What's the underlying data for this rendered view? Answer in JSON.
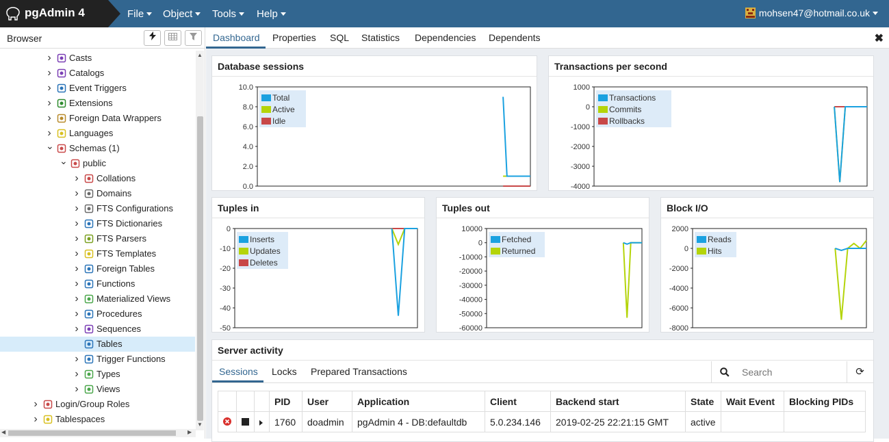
{
  "app": {
    "title": "pgAdmin 4"
  },
  "menu": {
    "file": "File",
    "object": "Object",
    "tools": "Tools",
    "help": "Help"
  },
  "user": {
    "email": "mohsen47@hotmail.co.uk"
  },
  "browser": {
    "title": "Browser",
    "tree": [
      {
        "label": "Casts",
        "icon": "casts-icon"
      },
      {
        "label": "Catalogs",
        "icon": "catalogs-icon"
      },
      {
        "label": "Event Triggers",
        "icon": "event-triggers-icon"
      },
      {
        "label": "Extensions",
        "icon": "extensions-icon"
      },
      {
        "label": "Foreign Data Wrappers",
        "icon": "fdw-icon"
      },
      {
        "label": "Languages",
        "icon": "languages-icon"
      },
      {
        "label": "Schemas (1)",
        "icon": "schemas-icon"
      },
      {
        "label": "public",
        "icon": "schema-icon"
      },
      {
        "label": "Collations",
        "icon": "collations-icon"
      },
      {
        "label": "Domains",
        "icon": "domains-icon"
      },
      {
        "label": "FTS Configurations",
        "icon": "fts-configurations-icon"
      },
      {
        "label": "FTS Dictionaries",
        "icon": "fts-dictionaries-icon"
      },
      {
        "label": "FTS Parsers",
        "icon": "fts-parsers-icon"
      },
      {
        "label": "FTS Templates",
        "icon": "fts-templates-icon"
      },
      {
        "label": "Foreign Tables",
        "icon": "foreign-tables-icon"
      },
      {
        "label": "Functions",
        "icon": "functions-icon"
      },
      {
        "label": "Materialized Views",
        "icon": "materialized-views-icon"
      },
      {
        "label": "Procedures",
        "icon": "procedures-icon"
      },
      {
        "label": "Sequences",
        "icon": "sequences-icon"
      },
      {
        "label": "Tables",
        "icon": "tables-icon"
      },
      {
        "label": "Trigger Functions",
        "icon": "trigger-functions-icon"
      },
      {
        "label": "Types",
        "icon": "types-icon"
      },
      {
        "label": "Views",
        "icon": "views-icon"
      },
      {
        "label": "Login/Group Roles",
        "icon": "roles-icon"
      },
      {
        "label": "Tablespaces",
        "icon": "tablespaces-icon"
      }
    ]
  },
  "tabs": [
    "Dashboard",
    "Properties",
    "SQL",
    "Statistics",
    "Dependencies",
    "Dependents"
  ],
  "panels": {
    "sessions": "Database sessions",
    "tps": "Transactions per second",
    "tuples_in": "Tuples in",
    "tuples_out": "Tuples out",
    "block_io": "Block I/O",
    "server_activity": "Server activity"
  },
  "activity": {
    "tabs": [
      "Sessions",
      "Locks",
      "Prepared Transactions"
    ],
    "search_placeholder": "Search",
    "columns": [
      "PID",
      "User",
      "Application",
      "Client",
      "Backend start",
      "State",
      "Wait Event",
      "Blocking PIDs"
    ],
    "rows": [
      {
        "pid": "1760",
        "user": "doadmin",
        "application": "pgAdmin 4 - DB:defaultdb",
        "client": "5.0.234.146",
        "backend_start": "2019-02-25 22:21:15 GMT",
        "state": "active",
        "wait_event": "",
        "blocking_pids": ""
      }
    ]
  },
  "colors": {
    "blue": "#1aa1e0",
    "green": "#b4d40a",
    "red": "#c84848",
    "header": "#326690"
  },
  "chart_data": [
    {
      "type": "line",
      "title": "Database sessions",
      "ylim": [
        0,
        10
      ],
      "yticks": [
        "10.0",
        "8.0",
        "6.0",
        "4.0",
        "2.0",
        "0.0"
      ],
      "legend": "top-left",
      "series": [
        {
          "name": "Total",
          "color": "#1aa1e0",
          "values": [
            9,
            1,
            1,
            1,
            1,
            1,
            1,
            1
          ]
        },
        {
          "name": "Active",
          "color": "#b4d40a",
          "values": [
            1,
            1,
            1,
            1,
            1,
            1,
            1,
            1
          ]
        },
        {
          "name": "Idle",
          "color": "#c84848",
          "values": [
            0,
            0,
            0,
            0,
            0,
            0,
            0,
            0
          ]
        }
      ]
    },
    {
      "type": "line",
      "title": "Transactions per second",
      "ylim": [
        -4000,
        1000
      ],
      "yticks": [
        "1000",
        "0",
        "-1000",
        "-2000",
        "-3000",
        "-4000"
      ],
      "legend": "top-left",
      "series": [
        {
          "name": "Transactions",
          "color": "#1aa1e0",
          "values": [
            0,
            -3800,
            0,
            0,
            0,
            0,
            0
          ]
        },
        {
          "name": "Commits",
          "color": "#b4d40a",
          "values": [
            0,
            -3800,
            0,
            0,
            0,
            0,
            0
          ]
        },
        {
          "name": "Rollbacks",
          "color": "#c84848",
          "values": [
            0,
            0,
            0,
            0,
            0,
            0,
            0
          ]
        }
      ]
    },
    {
      "type": "line",
      "title": "Tuples in",
      "ylim": [
        -50,
        0
      ],
      "yticks": [
        "0",
        "-10",
        "-20",
        "-30",
        "-40",
        "-50"
      ],
      "legend": "top-left",
      "series": [
        {
          "name": "Inserts",
          "color": "#1aa1e0",
          "values": [
            0,
            -44,
            0,
            0,
            0
          ]
        },
        {
          "name": "Updates",
          "color": "#b4d40a",
          "values": [
            0,
            -8,
            0,
            0,
            0
          ]
        },
        {
          "name": "Deletes",
          "color": "#c84848",
          "values": [
            0,
            0,
            0,
            0,
            0
          ]
        }
      ]
    },
    {
      "type": "line",
      "title": "Tuples out",
      "ylim": [
        -60000,
        10000
      ],
      "yticks": [
        "10000",
        "0",
        "-10000",
        "-20000",
        "-30000",
        "-40000",
        "-50000",
        "-60000"
      ],
      "legend": "top-left",
      "series": [
        {
          "name": "Fetched",
          "color": "#1aa1e0",
          "values": [
            0,
            -1000,
            0,
            0,
            0,
            0
          ]
        },
        {
          "name": "Returned",
          "color": "#b4d40a",
          "values": [
            0,
            -53000,
            0,
            0,
            0,
            0
          ]
        }
      ]
    },
    {
      "type": "line",
      "title": "Block I/O",
      "ylim": [
        -8000,
        2000
      ],
      "yticks": [
        "2000",
        "0",
        "-2000",
        "-4000",
        "-6000",
        "-8000"
      ],
      "legend": "top-left",
      "series": [
        {
          "name": "Reads",
          "color": "#1aa1e0",
          "values": [
            0,
            -200,
            0,
            0,
            0,
            0
          ]
        },
        {
          "name": "Hits",
          "color": "#b4d40a",
          "values": [
            0,
            -7200,
            0,
            500,
            0,
            800
          ]
        }
      ]
    }
  ]
}
